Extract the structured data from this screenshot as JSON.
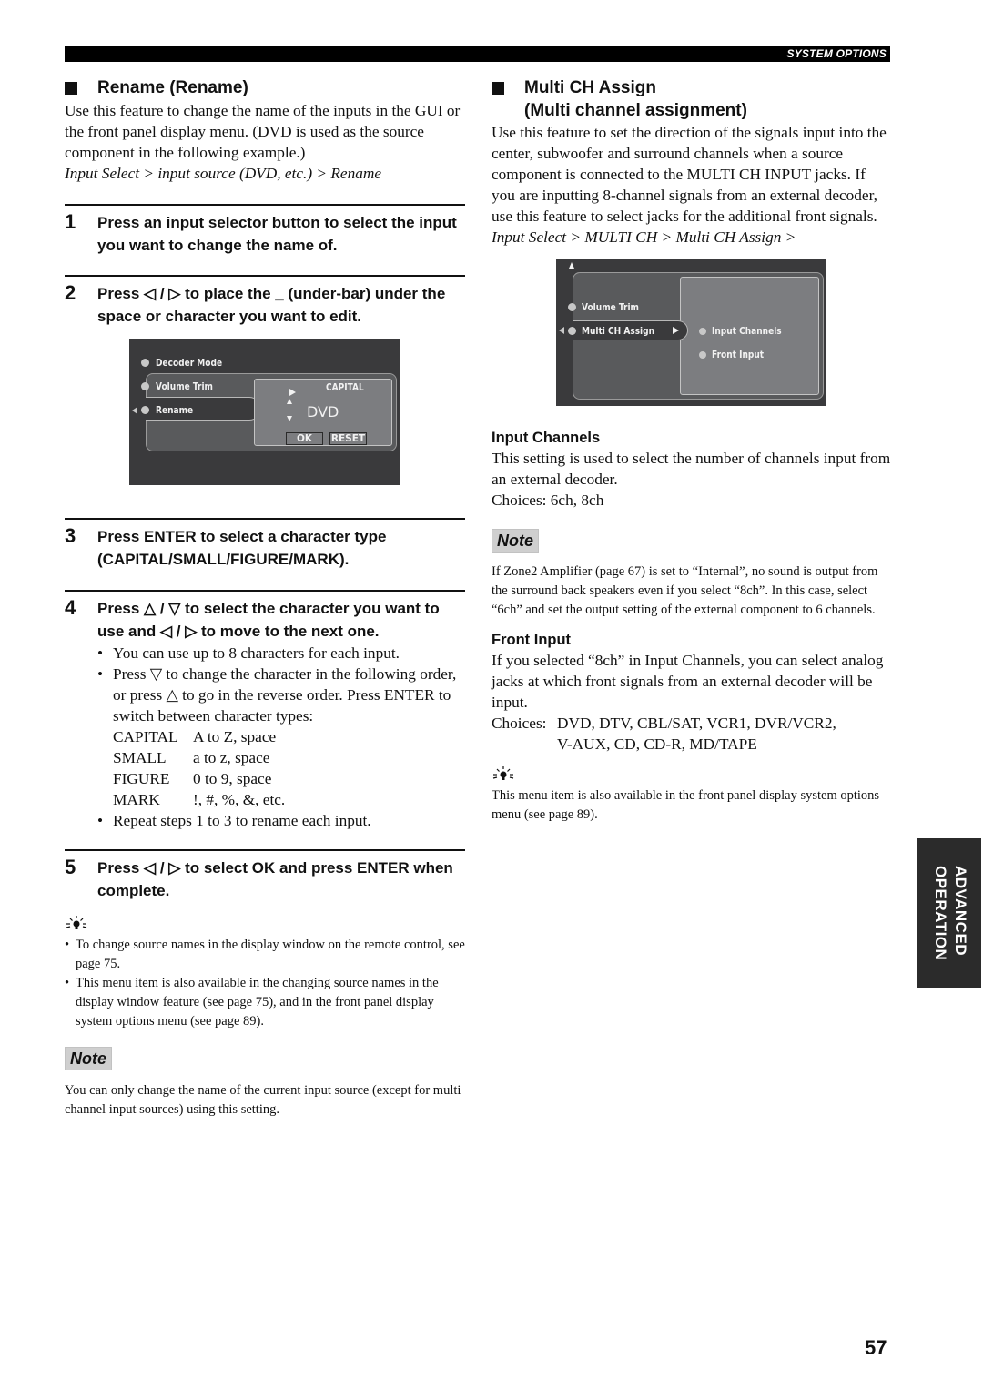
{
  "header": {
    "section_label": "SYSTEM OPTIONS"
  },
  "rename": {
    "heading": "Rename (Rename)",
    "intro": "Use this feature to change the name of the inputs in the GUI or the front panel display menu. (DVD is used as the source component in the following example.)",
    "path": "Input Select > input source (DVD, etc.) > Rename",
    "steps": [
      {
        "num": "1",
        "text": "Press an input selector button to select the input you want to change the name of."
      },
      {
        "num": "2",
        "text": "Press ◁ / ▷ to place the _ (under-bar) under the space or character you want to edit."
      },
      {
        "num": "3",
        "text": "Press ENTER to select a character type (CAPITAL/SMALL/FIGURE/MARK)."
      },
      {
        "num": "4",
        "text": "Press △ / ▽ to select the character you want to use and ◁ / ▷ to move to the next one."
      },
      {
        "num": "5",
        "text": "Press ◁ / ▷ to select OK and press ENTER when complete."
      }
    ],
    "step4_bullets": [
      "You can use up to 8 characters for each input.",
      "Press ▽ to change the character in the following order, or press △ to go in the reverse order. Press ENTER to switch between character types:"
    ],
    "char_types": [
      {
        "type": "CAPITAL",
        "range": "A to Z, space"
      },
      {
        "type": "SMALL",
        "range": "a to z, space"
      },
      {
        "type": "FIGURE",
        "range": "0 to 9, space"
      },
      {
        "type": "MARK",
        "range": "!, #, %, &, etc."
      }
    ],
    "step4_last_bullet": "Repeat steps 1 to 3 to rename each input.",
    "tips": [
      "To change source names in the display window on the remote control, see page 75.",
      "This menu item is also available in the changing source names in the display window feature (see page 75), and in the front panel display system options menu (see page 89)."
    ],
    "note_label": "Note",
    "note_text": "You can only change the name of the current input source (except for multi channel input sources) using this setting.",
    "osd": {
      "menu_items": [
        "Decoder Mode",
        "Volume Trim",
        "Rename"
      ],
      "char_type": "CAPITAL",
      "name_value": "DVD",
      "ok_label": "OK",
      "reset_label": "RESET"
    }
  },
  "multi_ch": {
    "heading_line1": "Multi CH Assign",
    "heading_line2": "(Multi channel assignment)",
    "intro": "Use this feature to set the direction of the signals input into the center, subwoofer and surround channels when a source component is connected to the MULTI CH INPUT jacks. If you are inputting 8-channel signals from an external decoder, use this feature to select jacks for the additional front signals.",
    "path": "Input Select > MULTI CH > Multi CH Assign >",
    "osd": {
      "menu_items": [
        "Volume Trim",
        "Multi CH Assign"
      ],
      "sub_items": [
        "Input Channels",
        "Front Input"
      ]
    },
    "input_channels": {
      "heading": "Input Channels",
      "text": "This setting is used to select the number of channels input from an external decoder.",
      "choices": "Choices: 6ch, 8ch"
    },
    "note_label": "Note",
    "note_text": "If Zone2 Amplifier (page 67) is set to “Internal”, no sound is output from the surround back speakers even if you select “8ch”. In this case, select “6ch” and set the output setting of the external component to 6 channels.",
    "front_input": {
      "heading": "Front Input",
      "text": "If you selected “8ch” in Input Channels, you can select analog jacks at which front signals from an external decoder will be input.",
      "choices_label": "Choices:",
      "choices_line1": "DVD, DTV, CBL/SAT, VCR1, DVR/VCR2,",
      "choices_line2": "V-AUX, CD, CD-R, MD/TAPE"
    },
    "tip": "This menu item is also available in the front panel display system options menu (see page 89)."
  },
  "side_tab": {
    "line1": "ADVANCED",
    "line2": "OPERATION"
  },
  "page_number": "57"
}
